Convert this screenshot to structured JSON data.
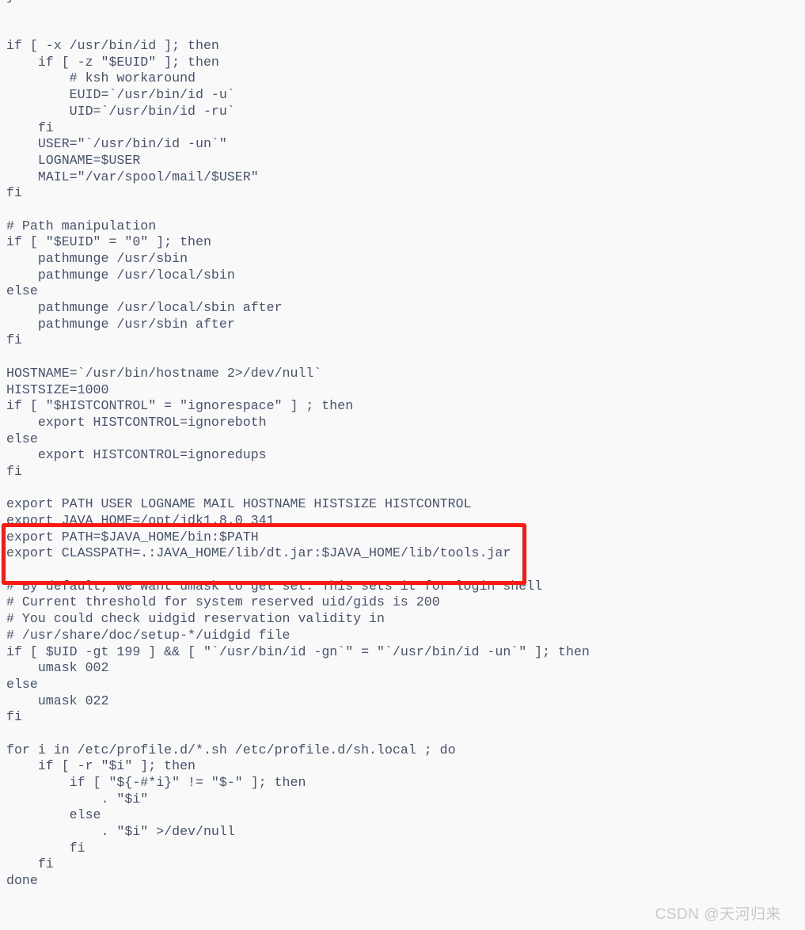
{
  "document": {
    "kind": "shell-script-listing",
    "language": "bash",
    "background_color": "#f9f9f9",
    "text_color": "#46536b"
  },
  "code": {
    "lines": [
      "}",
      "",
      "",
      "if [ -x /usr/bin/id ]; then",
      "    if [ -z \"$EUID\" ]; then",
      "        # ksh workaround",
      "        EUID=`/usr/bin/id -u`",
      "        UID=`/usr/bin/id -ru`",
      "    fi",
      "    USER=\"`/usr/bin/id -un`\"",
      "    LOGNAME=$USER",
      "    MAIL=\"/var/spool/mail/$USER\"",
      "fi",
      "",
      "# Path manipulation",
      "if [ \"$EUID\" = \"0\" ]; then",
      "    pathmunge /usr/sbin",
      "    pathmunge /usr/local/sbin",
      "else",
      "    pathmunge /usr/local/sbin after",
      "    pathmunge /usr/sbin after",
      "fi",
      "",
      "HOSTNAME=`/usr/bin/hostname 2>/dev/null`",
      "HISTSIZE=1000",
      "if [ \"$HISTCONTROL\" = \"ignorespace\" ] ; then",
      "    export HISTCONTROL=ignoreboth",
      "else",
      "    export HISTCONTROL=ignoredups",
      "fi",
      "",
      "export PATH USER LOGNAME MAIL HOSTNAME HISTSIZE HISTCONTROL",
      "export JAVA_HOME=/opt/jdk1.8.0_341",
      "export PATH=$JAVA_HOME/bin:$PATH",
      "export CLASSPATH=.:JAVA_HOME/lib/dt.jar:$JAVA_HOME/lib/tools.jar",
      "",
      "# By default, we want umask to get set. This sets it for login shell",
      "# Current threshold for system reserved uid/gids is 200",
      "# You could check uidgid reservation validity in",
      "# /usr/share/doc/setup-*/uidgid file",
      "if [ $UID -gt 199 ] && [ \"`/usr/bin/id -gn`\" = \"`/usr/bin/id -un`\" ]; then",
      "    umask 002",
      "else",
      "    umask 022",
      "fi",
      "",
      "for i in /etc/profile.d/*.sh /etc/profile.d/sh.local ; do",
      "    if [ -r \"$i\" ]; then",
      "        if [ \"${-#*i}\" != \"$-\" ]; then",
      "            . \"$i\"",
      "        else",
      "            . \"$i\" >/dev/null",
      "        fi",
      "    fi",
      "done"
    ],
    "clipped_bottom_line": "    ."
  },
  "annotation": {
    "type": "rectangle-highlight",
    "color": "#fa1a14",
    "border_width_px": 5,
    "highlighted_lines": [
      "export JAVA_HOME=/opt/jdk1.8.0_341",
      "export PATH=$JAVA_HOME/bin:$PATH",
      "export CLASSPATH=.:JAVA_HOME/lib/dt.jar:$JAVA_HOME/lib/tools.jar"
    ]
  },
  "watermark": {
    "text": "CSDN @天河归来",
    "color": "#c9c9c9"
  }
}
